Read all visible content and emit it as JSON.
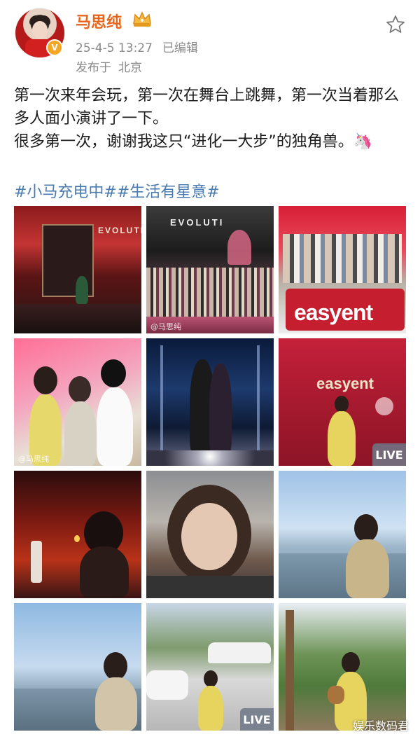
{
  "user": {
    "name": "马思纯",
    "verified_badge": "V",
    "avatar_icon": "avatar",
    "crown_icon": "crown-icon"
  },
  "post_meta": {
    "time": "25-4-5 13:27",
    "edited": "已编辑",
    "location_prefix": "发布于",
    "location": "北京"
  },
  "content": {
    "line1": "第一次来年会玩，第一次在舞台上跳舞，第一次当着那么多人面小演讲了一下。",
    "line2": "很多第一次，谢谢我这只“进化一大步”的独角兽。🦄",
    "hashtags": [
      "#小马充电中#",
      "#生活有星意#"
    ]
  },
  "photos": {
    "tile1": {
      "sign": "EVOLUTI"
    },
    "tile2": {
      "sign": "EVOLUTI",
      "watermark": "@马思纯"
    },
    "tile3": {
      "sign": "easyent"
    },
    "tile4": {
      "watermark": "@马思纯"
    },
    "tile6": {
      "sign": "easyent",
      "live": "LIVE"
    },
    "tile11": {
      "live": "LIVE"
    }
  },
  "footer": {
    "watermark": "娱乐数码君"
  },
  "colors": {
    "username": "#e8641b",
    "hashtag": "#4a7bb0",
    "meta": "#8a8a8a"
  }
}
